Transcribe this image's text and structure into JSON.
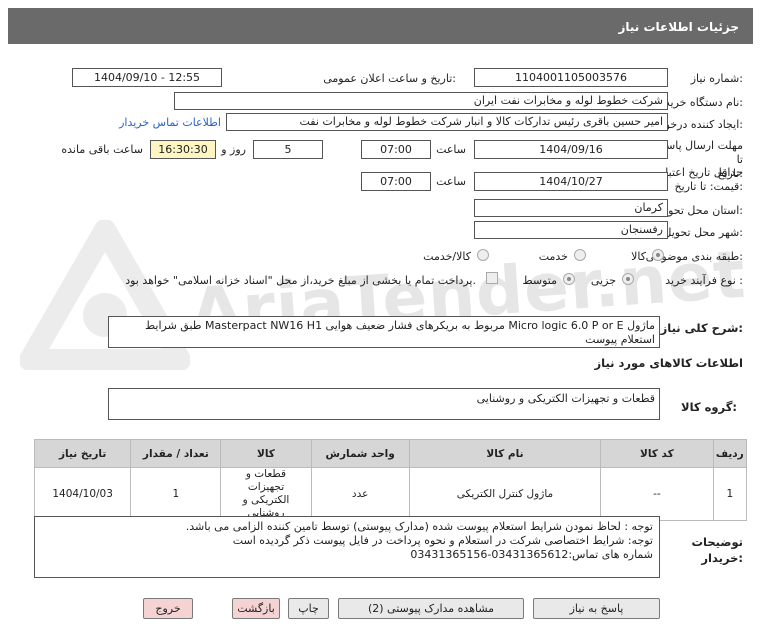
{
  "page_title": "جزئیات اطلاعات نیاز",
  "watermark": "AriaTender.net",
  "fields": {
    "need_number_label": "شماره نیاز:",
    "need_number": "1104001105003576",
    "announce_label": "تاریخ و ساعت اعلان عمومی:",
    "announce_value": "1404/09/10 - 12:55",
    "buyer_label": "نام دستگاه خریدار:",
    "buyer": "شرکت خطوط لوله و مخابرات نفت ایران",
    "creator_label": "ایجاد کننده درخواست:",
    "creator": "امیر حسین  باقری  رئیس تدارکات کالا و انبار  شرکت خطوط لوله و مخابرات نفت",
    "contact_link": "اطلاعات تماس خریدار",
    "deadline_label": "مهلت ارسال پاسخ: تا تاریخ:",
    "deadline_date": "1404/09/16",
    "time_label": "ساعت",
    "deadline_time": "07:00",
    "days_value": "5",
    "days_label": "روز و",
    "remaining_time": "16:30:30",
    "remaining_label": "ساعت باقی مانده",
    "validity_label": "حداقل تاریخ اعتبار قیمت: تا تاریخ:",
    "validity_date": "1404/10/27",
    "validity_time": "07:00",
    "province_label": "استان محل تحویل:",
    "province": "کرمان",
    "city_label": "شهر محل تحویل:",
    "city": "رفسنجان",
    "category_label": "طبقه بندی موضوعی:",
    "category_options": [
      "کالا",
      "خدمت",
      "کالا/خدمت"
    ],
    "category_selected": "کالا",
    "process_label": "نوع فرآیند خرید :",
    "process_options": [
      "جزیی",
      "متوسط"
    ],
    "process_selected": "جزیی",
    "payment_note": "پرداخت تمام یا بخشی از مبلغ خرید،از محل \"اسناد خزانه اسلامی\" خواهد بود."
  },
  "description": {
    "label": "شرح کلی نیاز:",
    "text_line1": "ماژول Micro logic 6.0 P or E مربوط به بریکرهای فشار ضعیف هوایی Masterpact NW16 H1 طبق شرایط",
    "text_line2": "استعلام پیوست"
  },
  "goods_section": {
    "title": "اطلاعات کالاهای مورد نیاز",
    "group_label": "گروه کالا:",
    "group_value": "قطعات و تجهیزات الکتریکی و روشنایی"
  },
  "table": {
    "headers": [
      "ردیف",
      "کد کالا",
      "نام کالا",
      "واحد شمارش",
      "کالا",
      "تعداد / مقدار",
      "تاریخ نیاز"
    ],
    "rows": [
      [
        "1",
        "--",
        "ماژول کنترل الکتریکی",
        "عدد",
        "قطعات و تجهیزات الکتریکی و روشنایی",
        "1",
        "1404/10/03"
      ]
    ]
  },
  "notes": {
    "label": "توضیحات خریدار:",
    "line1": "توجه : لحاظ نمودن شرایط استعلام پیوست شده (مدارک پیوستی) توسط تامین کننده الزامی می باشد.",
    "line2": "توجه: شرایط اختصاصی شرکت در استعلام و نحوه پرداخت در فایل پیوست ذکر گردیده است",
    "line3": "شماره های تماس:03431365612-03431365156"
  },
  "buttons": {
    "reply": "پاسخ به نیاز",
    "attachments": "مشاهده مدارک پیوستی (2)",
    "print": "چاپ",
    "back": "بازگشت",
    "exit": "خروج"
  }
}
